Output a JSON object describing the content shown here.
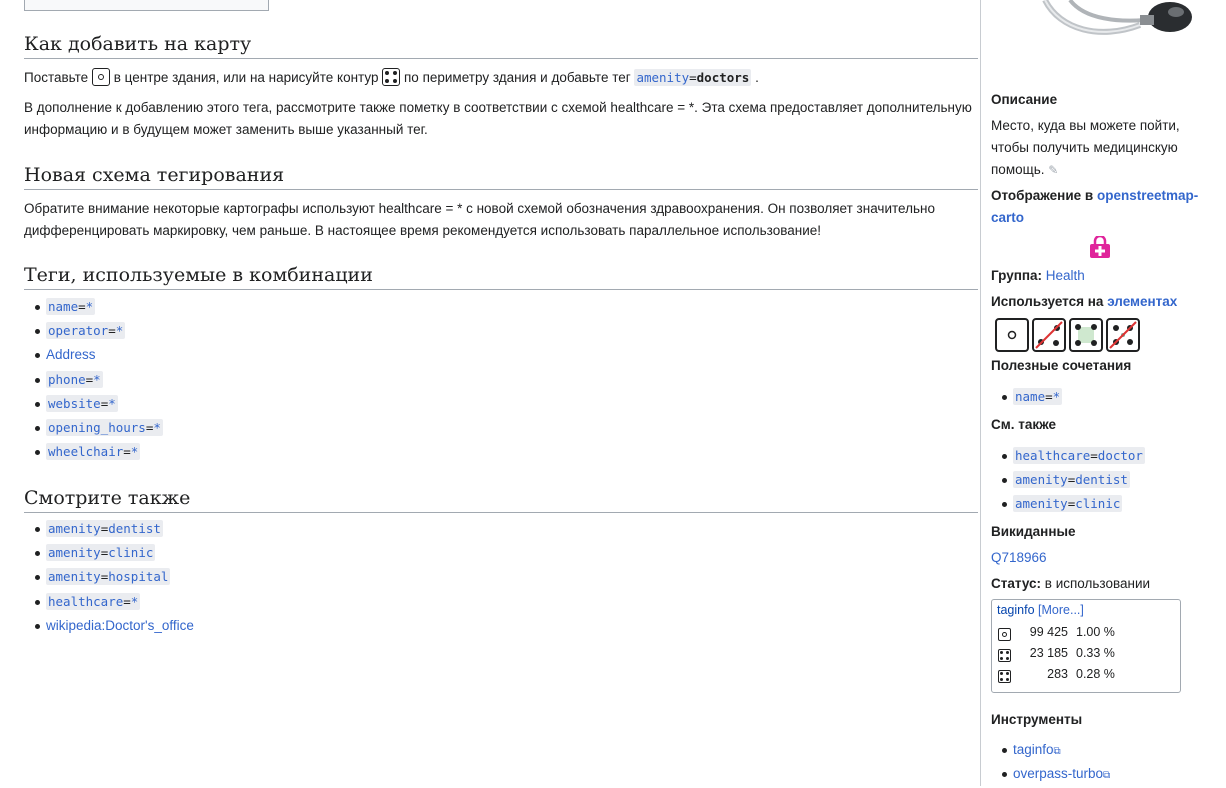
{
  "section1": {
    "heading": "Как добавить на карту",
    "p1_a": "Поставьте",
    "p1_b": "в центре здания, или на нарисуйте контур",
    "p1_c": "по периметру здания и добавьте тег",
    "p1_tag_key": "amenity",
    "p1_tag_val": "doctors",
    "p1_end": ".",
    "p2": "В дополнение к добавлению этого тега, рассмотрите также пометку в соответствии с схемой healthcare = *. Эта схема предоставляет дополнительную информацию и в будущем может заменить выше указанный тег."
  },
  "section2": {
    "heading": "Новая схема тегирования",
    "p1": "Обратите внимание некоторые картографы используют healthcare = * с новой схемой обозначения здравоохранения. Он позволяет значительно дифференцировать маркировку, чем раньше. В настоящее время рекомендуется использовать параллельное использование!"
  },
  "section3": {
    "heading": "Теги, используемые в комбинации",
    "items": [
      {
        "key": "name",
        "val": "*",
        "code": true
      },
      {
        "key": "operator",
        "val": "*",
        "code": true
      },
      {
        "text": "Address",
        "code": false
      },
      {
        "key": "phone",
        "val": "*",
        "code": true
      },
      {
        "key": "website",
        "val": "*",
        "code": true
      },
      {
        "key": "opening_hours",
        "val": "*",
        "code": true
      },
      {
        "key": "wheelchair",
        "val": "*",
        "code": true
      }
    ]
  },
  "section4": {
    "heading": "Смотрите также",
    "items": [
      {
        "key": "amenity",
        "val": "dentist",
        "code": true
      },
      {
        "key": "amenity",
        "val": "clinic",
        "code": true
      },
      {
        "key": "amenity",
        "val": "hospital",
        "code": true
      },
      {
        "key": "healthcare",
        "val": "*",
        "code": true
      },
      {
        "text": "wikipedia:Doctor's_office",
        "code": false
      }
    ]
  },
  "sidebar": {
    "description_label": "Описание",
    "description_text": "Место, куда вы можете пойти, чтобы получить медицинскую помощь.",
    "render_label": "Отображение в",
    "render_link": "openstreetmap-carto",
    "group_label": "Группа:",
    "group_value": "Health",
    "used_on_label": "Используется на",
    "used_on_link": "элементах",
    "useful_label": "Полезные сочетания",
    "useful_items": [
      {
        "key": "name",
        "val": "*"
      }
    ],
    "see_also_label": "См. также",
    "see_also_items": [
      {
        "key": "healthcare",
        "val": "doctor"
      },
      {
        "key": "amenity",
        "val": "dentist"
      },
      {
        "key": "amenity",
        "val": "clinic"
      }
    ],
    "wikidata_label": "Викиданные",
    "wikidata_value": "Q718966",
    "status_label": "Статус:",
    "status_value": "в использовании",
    "taginfo": {
      "title": "taginfo",
      "more": "[More...]",
      "rows": [
        {
          "icon": "node-icon",
          "count": "99 425",
          "pct": "1.00 %"
        },
        {
          "icon": "way-icon",
          "count": "23 185",
          "pct": "0.33 %"
        },
        {
          "icon": "relation-icon",
          "count": "283",
          "pct": "0.28 %"
        }
      ]
    },
    "tools_label": "Инструменты",
    "tools": [
      "taginfo",
      "overpass-turbo"
    ],
    "accent_color": "#e0249b"
  }
}
